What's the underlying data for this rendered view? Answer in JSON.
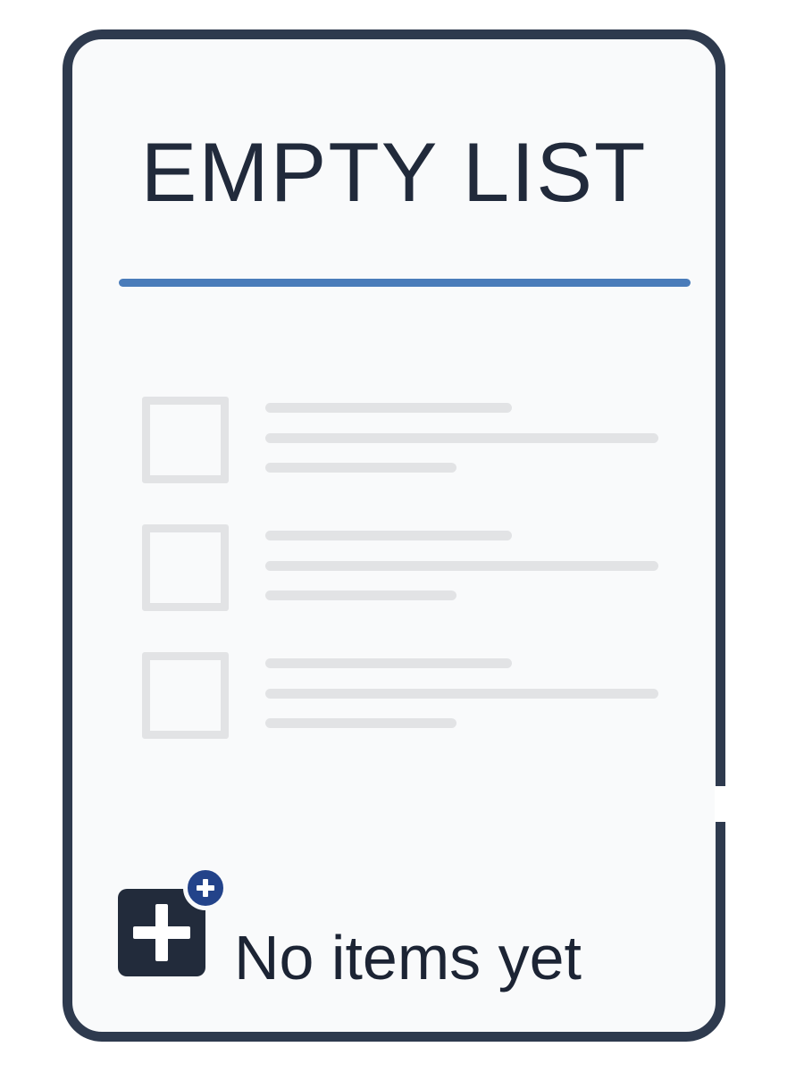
{
  "colors": {
    "border": "#2e3a4e",
    "title_text": "#212a3b",
    "divider_accent": "#4a7cba",
    "placeholder": "#e2e3e5",
    "icon_dark": "#222b3b",
    "badge_blue": "#23438a"
  },
  "list": {
    "title": "EMPTY LIST",
    "placeholder_rows": [
      {
        "icon": "checkbox-placeholder-icon",
        "checked": false
      },
      {
        "icon": "checkbox-placeholder-icon",
        "checked": false
      },
      {
        "icon": "checkbox-placeholder-icon",
        "checked": false
      }
    ]
  },
  "empty_state": {
    "icon": "add-item-icon",
    "badge_icon": "plus-badge-icon",
    "message": "No items yet"
  }
}
